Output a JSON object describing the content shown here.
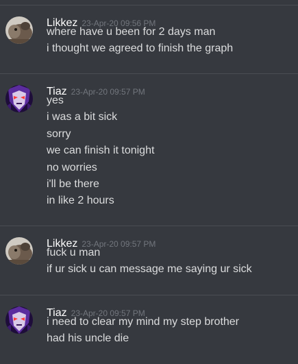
{
  "messages": [
    {
      "author": "Likkez",
      "avatar_icon": "camel-avatar-icon",
      "timestamp": "23-Apr-20 09:56 PM",
      "lines": [
        "where have u been for 2 days man",
        "i thought we agreed to finish the graph"
      ]
    },
    {
      "author": "Tiaz",
      "avatar_icon": "purple-villain-avatar-icon",
      "timestamp": "23-Apr-20 09:57 PM",
      "lines": [
        "yes",
        "i was a bit sick",
        "sorry",
        "we can finish it tonight",
        "no worries",
        "i'll be there",
        "in like 2 hours"
      ]
    },
    {
      "author": "Likkez",
      "avatar_icon": "camel-avatar-icon",
      "timestamp": "23-Apr-20 09:57 PM",
      "lines": [
        "fuck u man",
        "if ur sick u can message me saying ur sick"
      ]
    },
    {
      "author": "Tiaz",
      "avatar_icon": "purple-villain-avatar-icon",
      "timestamp": "23-Apr-20 09:57 PM",
      "lines": [
        "i need to clear my mind my step brother",
        "had his uncle die"
      ]
    }
  ],
  "colors": {
    "background": "#36393f",
    "username": "#ffffff",
    "timestamp": "#72767d",
    "message_text": "#dcddde",
    "divider": "#4a4d53"
  }
}
